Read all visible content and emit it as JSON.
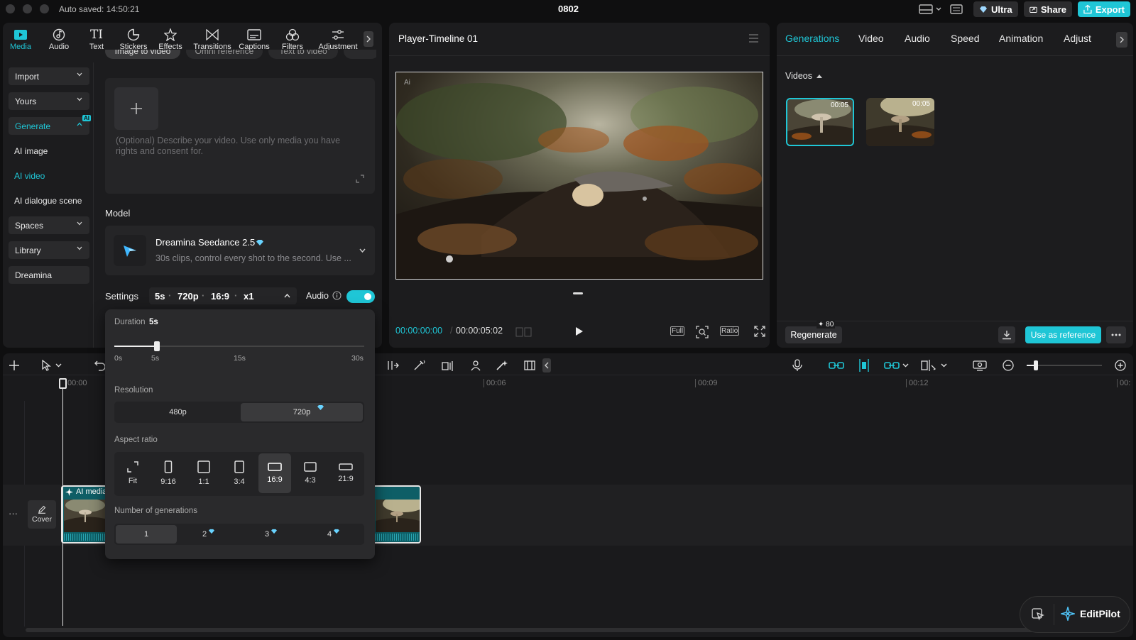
{
  "titlebar": {
    "autosave": "Auto saved: 14:50:21",
    "project_name": "0802",
    "ultra_label": "Ultra",
    "share_label": "Share",
    "export_label": "Export"
  },
  "toolbar": {
    "items": [
      {
        "label": "Media",
        "icon": "media-icon"
      },
      {
        "label": "Audio",
        "icon": "audio-icon"
      },
      {
        "label": "Text",
        "icon": "text-icon"
      },
      {
        "label": "Stickers",
        "icon": "stickers-icon"
      },
      {
        "label": "Effects",
        "icon": "effects-icon"
      },
      {
        "label": "Transitions",
        "icon": "transitions-icon"
      },
      {
        "label": "Captions",
        "icon": "captions-icon"
      },
      {
        "label": "Filters",
        "icon": "filters-icon"
      },
      {
        "label": "Adjustment",
        "icon": "adjustment-icon"
      }
    ]
  },
  "sidebar": {
    "import": "Import",
    "yours": "Yours",
    "generate": "Generate",
    "ai_badge": "AI",
    "ai_image": "AI image",
    "ai_video": "AI video",
    "ai_dialogue": "AI dialogue scene",
    "spaces": "Spaces",
    "library": "Library",
    "dreamina": "Dreamina"
  },
  "generate_panel": {
    "tabs": [
      "Image to video",
      "Omni reference",
      "Text to video"
    ],
    "prompt_placeholder": "(Optional) Describe your video. Use only media you have rights and consent for.",
    "model_heading": "Model",
    "model_name": "Dreamina Seedance 2.5",
    "model_desc": "30s clips, control every shot to the second. Use ...",
    "settings_label": "Settings",
    "settings_duration": "5s",
    "settings_resolution": "720p",
    "settings_ratio": "16:9",
    "settings_count": "x1",
    "audio_label": "Audio",
    "audio_on": true
  },
  "settings_popup": {
    "duration_label": "Duration",
    "duration_value": "5s",
    "duration_fraction": 0.2,
    "slider_ticks": [
      "0s",
      "5s",
      "15s",
      "30s"
    ],
    "resolution_label": "Resolution",
    "resolutions": [
      "480p",
      "720p"
    ],
    "selected_resolution": "720p",
    "aspect_label": "Aspect ratio",
    "aspects": [
      "Fit",
      "9:16",
      "1:1",
      "3:4",
      "16:9",
      "4:3",
      "21:9"
    ],
    "selected_aspect": "16:9",
    "generations_label": "Number of generations",
    "generations": [
      "1",
      "2",
      "3",
      "4"
    ],
    "selected_generation": "1"
  },
  "player": {
    "title": "Player-Timeline 01",
    "ai_watermark": "Ai",
    "current_time": "00:00:00:00",
    "total_time": "00:00:05:02",
    "full_label": "Full",
    "ratio_label": "Ratio"
  },
  "right_panel": {
    "tabs": [
      "Generations",
      "Video",
      "Audio",
      "Speed",
      "Animation",
      "Adjust"
    ],
    "active_tab": "Generations",
    "videos_heading": "Videos",
    "thumbs": [
      {
        "duration": "00:05"
      },
      {
        "duration": "00:05"
      }
    ],
    "cost": "80",
    "regenerate_label": "Regenerate",
    "use_reference_label": "Use as reference"
  },
  "timeline": {
    "ticks": [
      "00:00",
      "00:06",
      "00:09",
      "00:12",
      "00:"
    ],
    "clip_label": "AI media",
    "cover_label": "Cover"
  },
  "editpilot": {
    "label": "EditPilot"
  },
  "colors": {
    "accent": "#1fc6d6",
    "panel": "#1c1c1e",
    "background": "#0f0f10"
  }
}
